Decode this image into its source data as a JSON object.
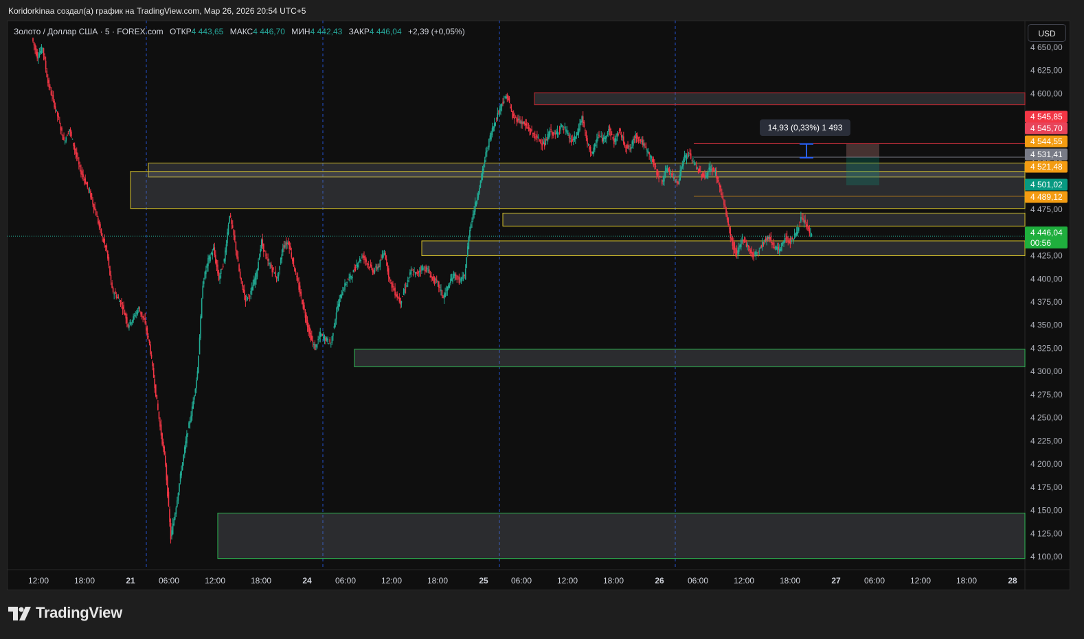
{
  "header": {
    "caption": "Koridorkinaa создал(а) график на TradingView.com, Мар 26, 2026 20:54 UTC+5"
  },
  "legend": {
    "symbol": "Золото / Доллар США · 5 · FOREX.com",
    "open_label": "ОТКР",
    "open": "4 443,65",
    "high_label": "МАКС",
    "high": "4 446,70",
    "low_label": "МИН",
    "low": "4 442,43",
    "close_label": "ЗАКР",
    "close": "4 446,04",
    "change": "+2,39 (+0,05%)"
  },
  "currency_button": "USD",
  "measure_tooltip": "14,93 (0,33%) 1 493",
  "branding": {
    "logo_text": "TradingView"
  },
  "colors": {
    "up": "#22ab94",
    "down": "#f23645",
    "zone_yellow": "#d4c12a",
    "zone_green": "#2ebd54",
    "zone_red": "#c3262f",
    "zone_fill": "rgba(120,123,134,0.28)",
    "session_line": "#2962ff"
  },
  "chart_data": {
    "type": "candlestick",
    "symbol": "XAUUSD",
    "timeframe": "5",
    "ylim": [
      4085,
      4660
    ],
    "y_ticks": [
      "4 650,00",
      "4 625,00",
      "4 600,00",
      "4 575,00",
      "4 550,00",
      "4 525,00",
      "4 500,00",
      "4 475,00",
      "4 450,00",
      "4 425,00",
      "4 400,00",
      "4 375,00",
      "4 350,00",
      "4 325,00",
      "4 300,00",
      "4 275,00",
      "4 250,00",
      "4 225,00",
      "4 200,00",
      "4 175,00",
      "4 150,00",
      "4 125,00",
      "4 100,00"
    ],
    "x_ticks": [
      "12:00",
      "18:00",
      "21",
      "06:00",
      "12:00",
      "18:00",
      "24",
      "06:00",
      "12:00",
      "18:00",
      "25",
      "06:00",
      "12:00",
      "18:00",
      "26",
      "06:00",
      "12:00",
      "18:00",
      "27",
      "06:00",
      "12:00",
      "18:00",
      "28"
    ],
    "session_breaks": [
      "21",
      "24",
      "25",
      "26"
    ],
    "price_path": [
      [
        0,
        4660
      ],
      [
        2,
        4640
      ],
      [
        4,
        4650
      ],
      [
        6,
        4612
      ],
      [
        8,
        4592
      ],
      [
        10,
        4572
      ],
      [
        12,
        4548
      ],
      [
        14,
        4562
      ],
      [
        16,
        4540
      ],
      [
        18,
        4518
      ],
      [
        20,
        4505
      ],
      [
        22,
        4490
      ],
      [
        24,
        4470
      ],
      [
        26,
        4448
      ],
      [
        28,
        4430
      ],
      [
        30,
        4388
      ],
      [
        32,
        4380
      ],
      [
        34,
        4370
      ],
      [
        36,
        4350
      ],
      [
        38,
        4358
      ],
      [
        40,
        4368
      ],
      [
        42,
        4355
      ],
      [
        44,
        4330
      ],
      [
        46,
        4285
      ],
      [
        48,
        4240
      ],
      [
        50,
        4200
      ],
      [
        52,
        4120
      ],
      [
        54,
        4155
      ],
      [
        56,
        4195
      ],
      [
        58,
        4230
      ],
      [
        60,
        4260
      ],
      [
        62,
        4300
      ],
      [
        64,
        4395
      ],
      [
        66,
        4420
      ],
      [
        68,
        4432
      ],
      [
        70,
        4400
      ],
      [
        72,
        4420
      ],
      [
        74,
        4470
      ],
      [
        76,
        4440
      ],
      [
        78,
        4400
      ],
      [
        80,
        4378
      ],
      [
        82,
        4385
      ],
      [
        84,
        4405
      ],
      [
        86,
        4440
      ],
      [
        88,
        4420
      ],
      [
        90,
        4410
      ],
      [
        92,
        4400
      ],
      [
        94,
        4435
      ],
      [
        96,
        4440
      ],
      [
        98,
        4415
      ],
      [
        100,
        4390
      ],
      [
        102,
        4365
      ],
      [
        104,
        4340
      ],
      [
        106,
        4325
      ],
      [
        108,
        4340
      ],
      [
        110,
        4335
      ],
      [
        112,
        4330
      ],
      [
        114,
        4365
      ],
      [
        116,
        4385
      ],
      [
        118,
        4398
      ],
      [
        120,
        4405
      ],
      [
        122,
        4418
      ],
      [
        124,
        4425
      ],
      [
        126,
        4415
      ],
      [
        128,
        4408
      ],
      [
        130,
        4415
      ],
      [
        132,
        4430
      ],
      [
        134,
        4398
      ],
      [
        136,
        4385
      ],
      [
        138,
        4375
      ],
      [
        140,
        4392
      ],
      [
        142,
        4408
      ],
      [
        144,
        4405
      ],
      [
        146,
        4412
      ],
      [
        148,
        4410
      ],
      [
        150,
        4400
      ],
      [
        152,
        4395
      ],
      [
        154,
        4380
      ],
      [
        156,
        4392
      ],
      [
        158,
        4405
      ],
      [
        160,
        4398
      ],
      [
        162,
        4402
      ],
      [
        164,
        4455
      ],
      [
        166,
        4480
      ],
      [
        168,
        4505
      ],
      [
        170,
        4535
      ],
      [
        172,
        4558
      ],
      [
        174,
        4575
      ],
      [
        176,
        4590
      ],
      [
        178,
        4598
      ],
      [
        180,
        4575
      ],
      [
        182,
        4572
      ],
      [
        184,
        4568
      ],
      [
        186,
        4562
      ],
      [
        188,
        4555
      ],
      [
        190,
        4550
      ],
      [
        192,
        4545
      ],
      [
        194,
        4560
      ],
      [
        196,
        4555
      ],
      [
        198,
        4565
      ],
      [
        200,
        4560
      ],
      [
        202,
        4548
      ],
      [
        204,
        4555
      ],
      [
        206,
        4575
      ],
      [
        208,
        4545
      ],
      [
        210,
        4535
      ],
      [
        212,
        4555
      ],
      [
        214,
        4550
      ],
      [
        216,
        4562
      ],
      [
        218,
        4548
      ],
      [
        220,
        4560
      ],
      [
        222,
        4545
      ],
      [
        224,
        4540
      ],
      [
        226,
        4555
      ],
      [
        228,
        4550
      ],
      [
        230,
        4540
      ],
      [
        232,
        4530
      ],
      [
        234,
        4515
      ],
      [
        236,
        4505
      ],
      [
        238,
        4520
      ],
      [
        240,
        4510
      ],
      [
        242,
        4505
      ],
      [
        244,
        4530
      ],
      [
        246,
        4535
      ],
      [
        248,
        4525
      ],
      [
        250,
        4515
      ],
      [
        252,
        4510
      ],
      [
        254,
        4520
      ],
      [
        256,
        4515
      ],
      [
        258,
        4495
      ],
      [
        260,
        4470
      ],
      [
        262,
        4440
      ],
      [
        264,
        4425
      ],
      [
        266,
        4445
      ],
      [
        268,
        4435
      ],
      [
        270,
        4425
      ],
      [
        272,
        4430
      ],
      [
        274,
        4440
      ],
      [
        276,
        4445
      ],
      [
        278,
        4435
      ],
      [
        280,
        4430
      ],
      [
        282,
        4445
      ],
      [
        284,
        4440
      ],
      [
        286,
        4448
      ],
      [
        288,
        4465
      ],
      [
        290,
        4458
      ],
      [
        292,
        4446
      ]
    ],
    "zones": [
      {
        "name": "supply-zone-top",
        "from_x": "06:00 (25)",
        "to_x": "right edge",
        "y_range": [
          4588,
          4601
        ],
        "border": "red"
      },
      {
        "name": "zone-4520",
        "from_x": "21",
        "to_x": "right edge",
        "y_range": [
          4510,
          4525
        ],
        "border": "yellow"
      },
      {
        "name": "zone-4480",
        "from_x": "18:00 (20)",
        "to_x": "right edge",
        "y_range": [
          4476,
          4516
        ],
        "border": "yellow"
      },
      {
        "name": "zone-4465",
        "from_x": "25 open",
        "to_x": "right edge",
        "y_range": [
          4457,
          4471
        ],
        "border": "yellow"
      },
      {
        "name": "zone-4435",
        "from_x": "18:00 (24)",
        "to_x": "right edge",
        "y_range": [
          4425,
          4441
        ],
        "border": "yellow"
      },
      {
        "name": "demand-zone-4315",
        "from_x": "06:00 (24)",
        "to_x": "right edge",
        "y_range": [
          4305,
          4324
        ],
        "border": "green"
      },
      {
        "name": "demand-zone-4125",
        "from_x": "12:00 (21)",
        "to_x": "right edge",
        "y_range": [
          4098,
          4147
        ],
        "border": "green"
      }
    ],
    "price_labels": [
      {
        "value": "4 545,85",
        "color": "#f23645"
      },
      {
        "value": "4 545,70",
        "color": "#e8445a"
      },
      {
        "value": "4 544,55",
        "color": "#f39c12"
      },
      {
        "value": "4 531,41",
        "color": "#787b86"
      },
      {
        "value": "4 521,48",
        "color": "#f39c12"
      },
      {
        "value": "4 501,02",
        "color": "#089981"
      },
      {
        "value": "4 489,12",
        "color": "#f39c12"
      },
      {
        "value": "4 446,04",
        "color": "#1fae3d"
      }
    ],
    "countdown": "00:56",
    "current_price": 4446.04,
    "grid": false,
    "xlabel": "",
    "ylabel": ""
  }
}
